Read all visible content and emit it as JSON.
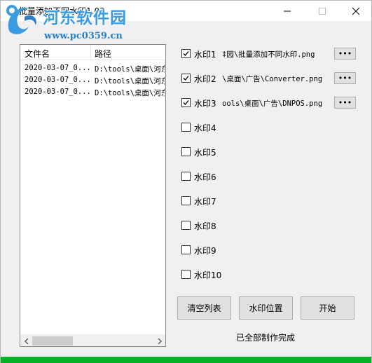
{
  "window": {
    "title": "批量添加不同水印1.03",
    "minimize_glyph": "—",
    "maximize_glyph": "☐",
    "close_glyph": "✕"
  },
  "overlay_watermark": {
    "name": "河东软件园",
    "url": "www.pc0359.cn"
  },
  "file_list": {
    "columns": [
      "文件名",
      "路径"
    ],
    "rows": [
      {
        "name": "2020-03-07_0...",
        "path": "D:\\tools\\桌面\\河东"
      },
      {
        "name": "2020-03-07_0...",
        "path": "D:\\tools\\桌面\\河东"
      },
      {
        "name": "2020-03-07_0...",
        "path": "D:\\tools\\桌面\\河东"
      }
    ]
  },
  "watermarks": [
    {
      "label": "水印1",
      "checked": true,
      "path": "‡园\\批量添加不同水印.png",
      "browse": "•••"
    },
    {
      "label": "水印2",
      "checked": true,
      "path": "\\桌面\\广告\\Converter.png",
      "browse": "•••"
    },
    {
      "label": "水印3",
      "checked": true,
      "path": "ools\\桌面\\广告\\DNPOS.png",
      "browse": "•••"
    },
    {
      "label": "水印4",
      "checked": false
    },
    {
      "label": "水印5",
      "checked": false
    },
    {
      "label": "水印6",
      "checked": false
    },
    {
      "label": "水印7",
      "checked": false
    },
    {
      "label": "水印8",
      "checked": false
    },
    {
      "label": "水印9",
      "checked": false
    },
    {
      "label": "水印10",
      "checked": false
    }
  ],
  "buttons": {
    "clear": "清空列表",
    "position": "水印位置",
    "start": "开始"
  },
  "status_text": "已全部制作完成",
  "progress": 1.0,
  "colors": {
    "progress": "#06b025",
    "logo": "#3a9be0"
  },
  "icons": {
    "app": "app-icon",
    "checkmark": "check-icon",
    "scroll_left": "chevron-left-icon",
    "scroll_right": "chevron-right-icon"
  }
}
